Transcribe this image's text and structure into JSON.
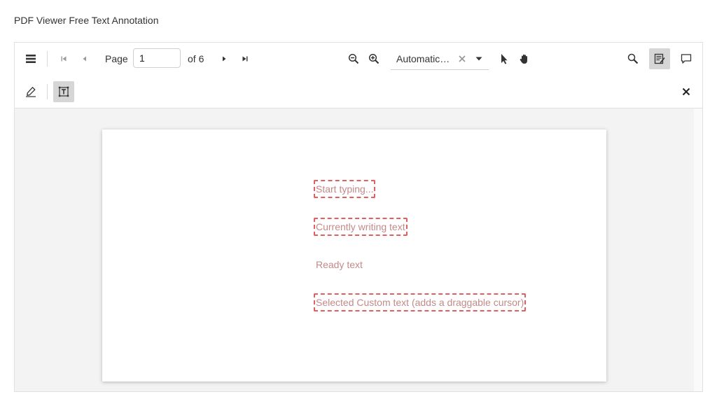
{
  "page_title": "PDF Viewer Free Text Annotation",
  "toolbar": {
    "page_label": "Page",
    "current_page": "1",
    "page_of": "of 6",
    "zoom_value": "Automatic Zoom",
    "icons": [
      "menu-icon",
      "first-page-icon",
      "previous-page-icon",
      "next-page-icon",
      "last-page-icon",
      "zoom-out-icon",
      "zoom-in-icon",
      "clear-icon",
      "dropdown-arrow-icon",
      "select-cursor-icon",
      "pan-hand-icon",
      "search-icon",
      "annotation-edit-icon",
      "comment-icon"
    ]
  },
  "annotation_toolbar": {
    "icons": [
      "ink-pen-icon",
      "free-text-icon",
      "close-icon"
    ]
  },
  "document": {
    "annotations": [
      {
        "text": "Start typing...",
        "state": "empty"
      },
      {
        "text": "Currently writing text",
        "state": "editing"
      },
      {
        "text": "Ready text",
        "state": "ready"
      },
      {
        "text": "Selected Custom text (adds a draggable cursor)",
        "state": "selected"
      }
    ]
  },
  "colors": {
    "annotation_text": "#c38a8a",
    "annotation_border": "#e35f5f",
    "active_tool_bg": "#d6d6d6"
  }
}
